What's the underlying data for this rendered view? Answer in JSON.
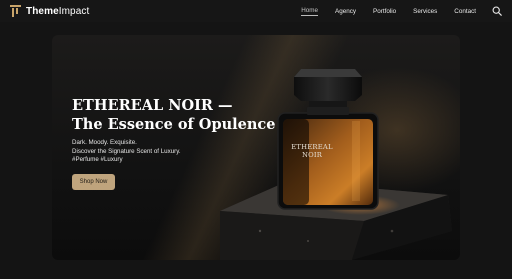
{
  "brand": {
    "name_bold": "Theme",
    "name_light": "Impact"
  },
  "nav": {
    "items": [
      {
        "label": "Home",
        "active": true
      },
      {
        "label": "Agency",
        "active": false
      },
      {
        "label": "Portfolio",
        "active": false
      },
      {
        "label": "Services",
        "active": false
      },
      {
        "label": "Contact",
        "active": false
      }
    ],
    "search_icon": "search-icon"
  },
  "hero": {
    "title_line1": "ETHEREAL NOIR —",
    "title_line2": "The Essence of Opulence",
    "desc_line1": "Dark. Moody. Exquisite.",
    "desc_line2": "Discover the Signature Scent of Luxury.",
    "desc_line3": "#Perfume #Luxury",
    "cta_label": "Shop Now",
    "bottle_label_line1": "ETHEREAL",
    "bottle_label_line2": "NOIR"
  },
  "colors": {
    "accent_gold": "#c9a46a",
    "button_bg": "#bfa47d",
    "page_bg": "#141414",
    "perfume_amber": "#b2661e"
  }
}
